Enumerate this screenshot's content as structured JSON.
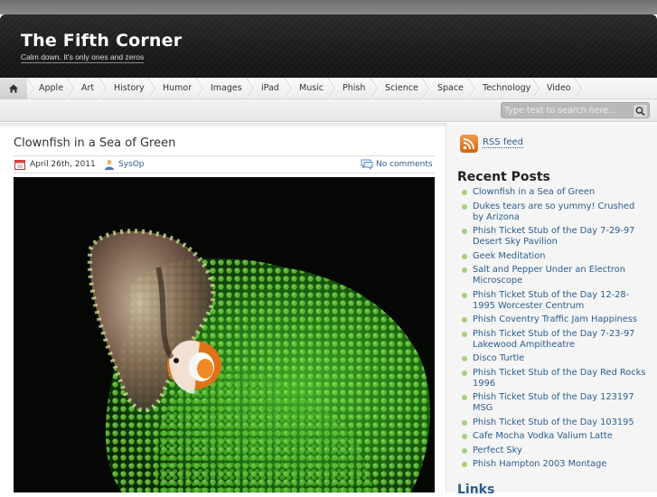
{
  "site": {
    "title": "The Fifth Corner",
    "description": "Calm down. It's only ones and zeros"
  },
  "nav": {
    "home_icon": "home-icon",
    "items": [
      "Apple",
      "Art",
      "History",
      "Humor",
      "Images",
      "iPad",
      "Music",
      "Phish",
      "Science",
      "Space",
      "Technology",
      "Video"
    ]
  },
  "search": {
    "placeholder": "Type text to search here...",
    "icon": "search-icon"
  },
  "post": {
    "title": "Clownfish in a Sea of Green",
    "date": "April 26th, 2011",
    "author": "SysOp",
    "comments": "No comments",
    "image": "clownfish-anemone-photo"
  },
  "sidebar": {
    "rss_label": "RSS feed",
    "recent_heading": "Recent Posts",
    "recent_posts": [
      "Clownfish in a Sea of Green",
      "Dukes tears are so yummy! Crushed by Arizona",
      "Phish Ticket Stub of the Day 7-29-97 Desert Sky Pavilion",
      "Geek Meditation",
      "Salt and Pepper Under an Electron Microscope",
      "Phish Ticket Stub of the Day 12-28-1995 Worcester Centrum",
      "Phish Coventry Traffic Jam Happiness",
      "Phish Ticket Stub of the Day 7-23-97 Lakewood Ampitheatre",
      "Disco Turtle",
      "Phish Ticket Stub of the Day Red Rocks 1996",
      "Phish Ticket Stub of the Day 123197 MSG",
      "Phish Ticket Stub of the Day 103195",
      "Cafe Mocha Vodka Valium Latte",
      "Perfect Sky",
      "Phish Hampton 2003 Montage"
    ],
    "links_heading": "Links"
  },
  "colors": {
    "link": "#2a5d8f",
    "header_bg": "#1a1a1a",
    "bullet": "#a5d07e",
    "rss": "#f08a2c"
  }
}
